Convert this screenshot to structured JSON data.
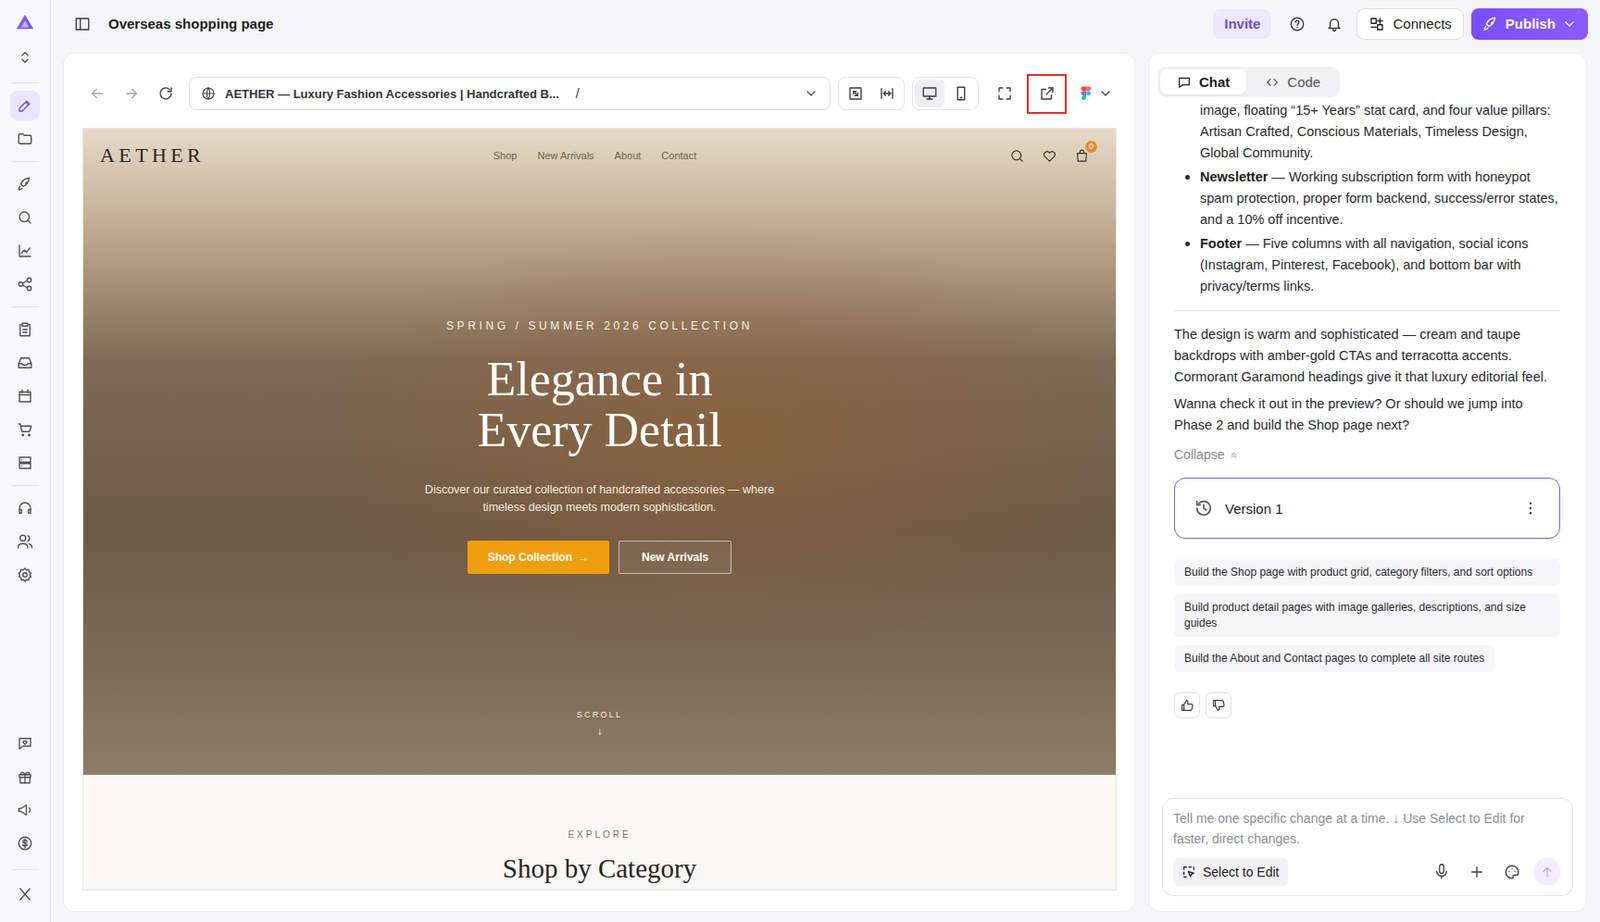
{
  "project": {
    "title": "Overseas shopping page"
  },
  "rail": {
    "groups": [
      [
        {
          "selected": true
        },
        {
          "selected": false
        }
      ],
      [
        {
          "selected": false
        },
        {
          "selected": false
        },
        {
          "selected": false
        },
        {
          "selected": false
        }
      ],
      [
        {
          "selected": false
        },
        {
          "selected": false
        },
        {
          "selected": false
        },
        {
          "selected": false
        },
        {
          "selected": false
        }
      ],
      [
        {
          "selected": false
        },
        {
          "selected": false
        },
        {
          "selected": false
        }
      ]
    ],
    "bottom_groups": [
      [
        {
          "selected": false
        },
        {
          "selected": false
        },
        {
          "selected": false
        },
        {
          "selected": false
        }
      ],
      [
        {
          "selected": false
        }
      ]
    ]
  },
  "topbar": {
    "invite": "Invite",
    "connects": "Connects",
    "publish": "Publish"
  },
  "browser": {
    "page_title": "AETHER — Luxury Fashion Accessories | Handcrafted B...",
    "path": "/",
    "view_modes": [
      {
        "selected": true
      },
      {
        "selected": false
      }
    ],
    "open_external_highlighted": true
  },
  "site": {
    "logo": "AETHER",
    "nav": [
      "Shop",
      "New Arrivals",
      "About",
      "Contact"
    ],
    "cart_count": "0",
    "hero": {
      "eyebrow": "SPRING / SUMMER 2026 COLLECTION",
      "title": "Elegance in Every Detail",
      "subtitle": "Discover our curated collection of handcrafted accessories — where timeless design meets modern sophistication.",
      "primary": "Shop Collection",
      "primary_arrow": "→",
      "secondary": "New Arrivals",
      "scroll": "SCROLL",
      "scroll_arrow": "↓"
    },
    "section": {
      "eyebrow": "EXPLORE",
      "title": "Shop by Category"
    }
  },
  "chat": {
    "tabs": [
      {
        "label": "Chat",
        "selected": true
      },
      {
        "label": "Code",
        "selected": false
      }
    ],
    "messages": [
      {
        "kind": "bullets",
        "items": [
          {
            "bullet": false,
            "bold": "",
            "text": "image, floating “15+ Years” stat card, and four value pillars: Artisan Crafted, Conscious Materials, Timeless Design, Global Community."
          },
          {
            "bullet": true,
            "bold": "Newsletter",
            "text": "— Working subscription form with honeypot spam protection, proper form backend, success/error states, and a 10% off incentive."
          },
          {
            "bullet": true,
            "bold": "Footer",
            "text": "— Five columns with all navigation, social icons (Instagram, Pinterest, Facebook), and bottom bar with privacy/terms links."
          }
        ]
      },
      {
        "kind": "divider"
      },
      {
        "kind": "paragraph",
        "text": "The design is warm and sophisticated — cream and taupe backdrops with amber-gold CTAs and terracotta accents. Cormorant Garamond headings give it that luxury editorial feel."
      },
      {
        "kind": "paragraph",
        "text": "Wanna check it out in the preview? Or should we jump into Phase 2 and build the Shop page next?"
      }
    ],
    "collapse": "Collapse",
    "version": {
      "label": "Version 1"
    },
    "suggestions": [
      "Build the Shop page with product grid, category filters, and sort options",
      "Build product detail pages with image galleries, descriptions, and size guides",
      "Build the About and Contact pages to complete all site routes"
    ],
    "input": {
      "placeholder": "Tell me one specific change at a time. ↓ Use Select to Edit for faster, direct changes.",
      "select_to_edit": "Select to Edit",
      "send_disabled": true
    }
  }
}
